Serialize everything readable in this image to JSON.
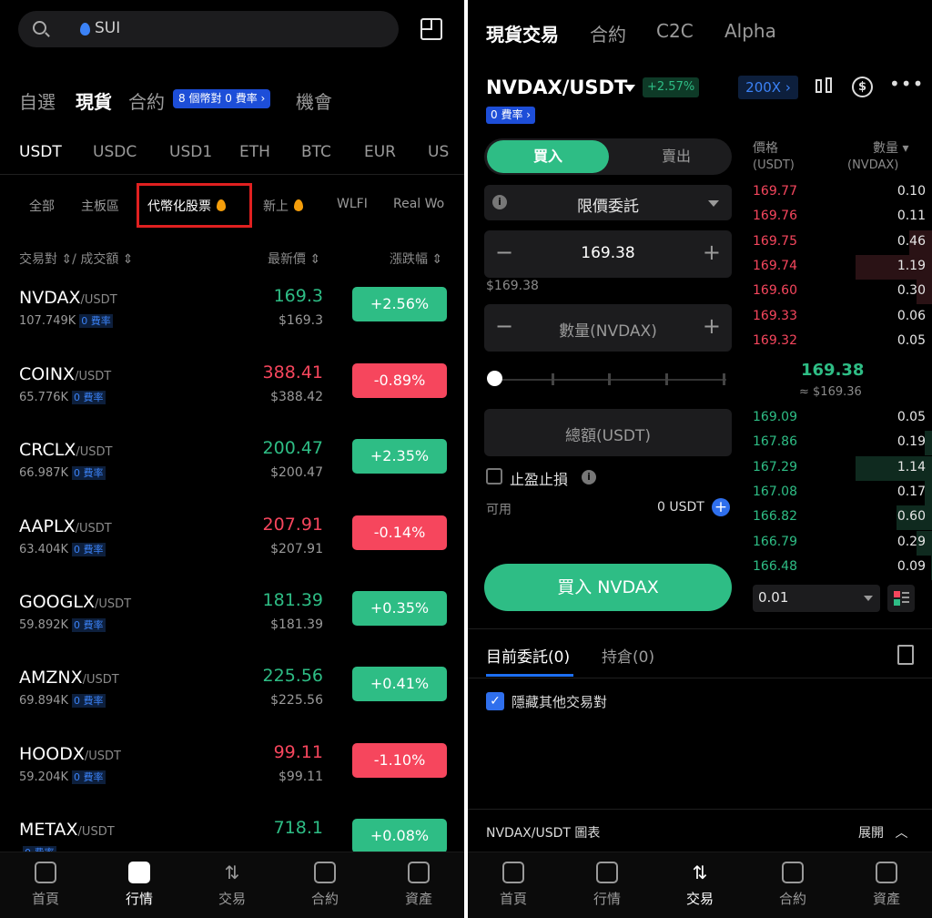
{
  "left": {
    "search": {
      "text": "SUI"
    },
    "categories": [
      "自選",
      "現貨",
      "合約",
      "機會"
    ],
    "category_badge": "8 個幣對 0 費率 ›",
    "quotes": [
      "USDT",
      "USDC",
      "USD1",
      "ETH",
      "BTC",
      "EUR",
      "US"
    ],
    "subtabs": [
      "全部",
      "主板區",
      "代幣化股票",
      "新上",
      "WLFI",
      "Real Wo"
    ],
    "column_headers": {
      "pair": "交易對 ⇕/ 成交額 ⇕",
      "price": "最新價 ⇕",
      "change": "漲跌幅 ⇕"
    },
    "fee_label": "0 費率",
    "rows": [
      {
        "symbol": "NVDAX",
        "quote": "/USDT",
        "volume": "107.749K",
        "price": "169.3",
        "usd": "$169.3",
        "change": "+2.56%",
        "dir": "up"
      },
      {
        "symbol": "COINX",
        "quote": "/USDT",
        "volume": "65.776K",
        "price": "388.41",
        "usd": "$388.42",
        "change": "-0.89%",
        "dir": "down"
      },
      {
        "symbol": "CRCLX",
        "quote": "/USDT",
        "volume": "66.987K",
        "price": "200.47",
        "usd": "$200.47",
        "change": "+2.35%",
        "dir": "up"
      },
      {
        "symbol": "AAPLX",
        "quote": "/USDT",
        "volume": "63.404K",
        "price": "207.91",
        "usd": "$207.91",
        "change": "-0.14%",
        "dir": "down"
      },
      {
        "symbol": "GOOGLX",
        "quote": "/USDT",
        "volume": "59.892K",
        "price": "181.39",
        "usd": "$181.39",
        "change": "+0.35%",
        "dir": "up"
      },
      {
        "symbol": "AMZNX",
        "quote": "/USDT",
        "volume": "69.894K",
        "price": "225.56",
        "usd": "$225.56",
        "change": "+0.41%",
        "dir": "up"
      },
      {
        "symbol": "HOODX",
        "quote": "/USDT",
        "volume": "59.204K",
        "price": "99.11",
        "usd": "$99.11",
        "change": "-1.10%",
        "dir": "down"
      },
      {
        "symbol": "METAX",
        "quote": "/USDT",
        "volume": "",
        "price": "718.1",
        "usd": "",
        "change": "+0.08%",
        "dir": "up"
      }
    ],
    "nav": [
      {
        "label": "首頁",
        "icon": "home-icon"
      },
      {
        "label": "行情",
        "icon": "chart-icon"
      },
      {
        "label": "交易",
        "icon": "swap-icon"
      },
      {
        "label": "合約",
        "icon": "contract-icon"
      },
      {
        "label": "資產",
        "icon": "wallet-icon"
      }
    ]
  },
  "right": {
    "tabs": [
      "現貨交易",
      "合約",
      "C2C",
      "Alpha"
    ],
    "pair": "NVDAX/USDT",
    "pair_change": "+2.57%",
    "fee_badge": "0 費率 ›",
    "leverage": "200X ›",
    "buy_label": "買入",
    "sell_label": "賣出",
    "order_type": "限價委託",
    "price_input": "169.38",
    "price_usd": "$169.38",
    "qty_placeholder": "數量(NVDAX)",
    "total_placeholder": "總額(USDT)",
    "tpsl_label": "止盈止損",
    "available_label": "可用",
    "available_value": "0 USDT",
    "buy_button": "買入  NVDAX",
    "orderbook": {
      "price_header": "價格",
      "price_unit": "(USDT)",
      "qty_header": "數量 ▾",
      "qty_unit": "(NVDAX)",
      "asks": [
        {
          "price": "169.77",
          "qty": "0.10",
          "depth": 0.0
        },
        {
          "price": "169.76",
          "qty": "0.11",
          "depth": 0.0
        },
        {
          "price": "169.75",
          "qty": "0.46",
          "depth": 0.35
        },
        {
          "price": "169.74",
          "qty": "1.19",
          "depth": 1.0
        },
        {
          "price": "169.60",
          "qty": "0.30",
          "depth": 0.25
        },
        {
          "price": "169.33",
          "qty": "0.06",
          "depth": 0.05
        },
        {
          "price": "169.32",
          "qty": "0.05",
          "depth": 0.04
        }
      ],
      "mid_price": "169.38",
      "mid_usd": "≈ $169.36",
      "bids": [
        {
          "price": "169.09",
          "qty": "0.05",
          "depth": 0.04
        },
        {
          "price": "167.86",
          "qty": "0.19",
          "depth": 0.16
        },
        {
          "price": "167.29",
          "qty": "1.14",
          "depth": 1.0
        },
        {
          "price": "167.08",
          "qty": "0.17",
          "depth": 0.15
        },
        {
          "price": "166.82",
          "qty": "0.60",
          "depth": 0.5
        },
        {
          "price": "166.79",
          "qty": "0.29",
          "depth": 0.25
        },
        {
          "price": "166.48",
          "qty": "0.09",
          "depth": 0.08
        }
      ],
      "tick_size": "0.01"
    },
    "order_tabs": [
      "目前委託(0)",
      "持倉(0)"
    ],
    "hide_other_pairs": "隱藏其他交易對",
    "chart_bar_label": "NVDAX/USDT 圖表",
    "expand_label": "展開"
  },
  "colors": {
    "up": "#2ebd85",
    "down": "#f6465d",
    "accent": "#1d4ed8",
    "highlight": "#e02020"
  }
}
